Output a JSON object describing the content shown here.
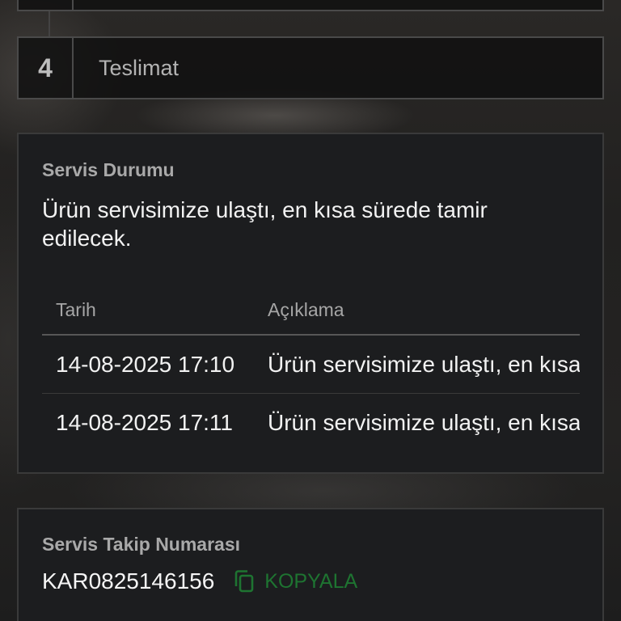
{
  "steps": {
    "current": {
      "number": "4",
      "label": "Teslimat"
    }
  },
  "service_status": {
    "title": "Servis Durumu",
    "message": "Ürün servisimize ulaştı, en kısa sürede tamir edilecek.",
    "table": {
      "headers": [
        "Tarih",
        "Açıklama"
      ],
      "rows": [
        {
          "date": "14-08-2025 17:10",
          "description": "Ürün servisimize ulaştı, en kısa"
        },
        {
          "date": "14-08-2025 17:11",
          "description": "Ürün servisimize ulaştı, en kısa"
        }
      ]
    }
  },
  "tracking": {
    "title": "Servis Takip Numarası",
    "number": "KAR0825146156",
    "copy_label": "KOPYALA",
    "copy_icon": "copy-icon"
  },
  "colors": {
    "card_background": "#1c1d1f",
    "border": "#3a3a3a",
    "text_primary": "#f2f2f2",
    "text_muted": "#a9a9a9",
    "copy_accent": "#1e7431"
  }
}
